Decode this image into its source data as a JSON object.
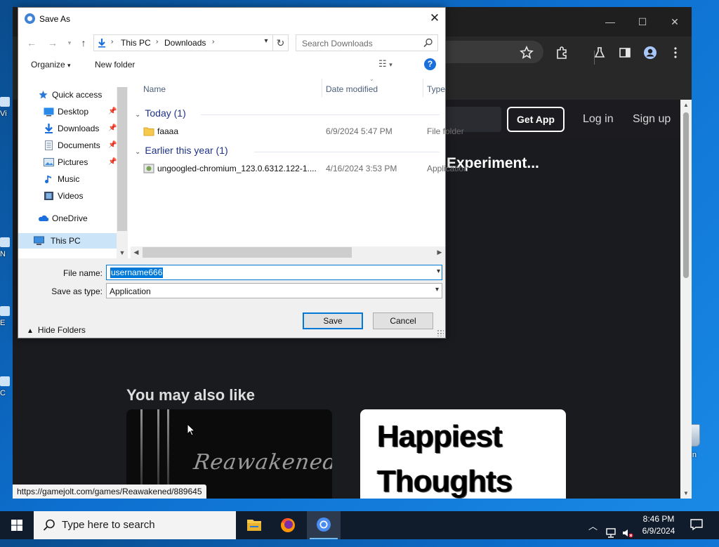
{
  "desktop": {
    "left_labels": [
      "Vi",
      "N",
      "E",
      "C"
    ],
    "recycle_label": "Bin"
  },
  "browser": {
    "window_controls": [
      "—",
      "☐",
      "✕"
    ],
    "site": {
      "get_app": "Get App",
      "log_in": "Log in",
      "sign_up": "Sign up",
      "headline": "Experiment...",
      "section_title": "You may also like",
      "card1_art": "Reawakened",
      "card2_art_line1": "Happiest",
      "card2_art_line2": "Thoughts"
    },
    "status_url": "https://gamejolt.com/games/Reawakened/889645"
  },
  "dialog": {
    "title": "Save As",
    "close": "✕",
    "address": {
      "crumbs": [
        "This PC",
        "Downloads"
      ]
    },
    "search_placeholder": "Search Downloads",
    "commands": {
      "organize": "Organize",
      "new_folder": "New folder"
    },
    "nav": {
      "quick_access": "Quick access",
      "items": [
        {
          "label": "Desktop",
          "icon": "desktop-icon"
        },
        {
          "label": "Downloads",
          "icon": "downloads-icon"
        },
        {
          "label": "Documents",
          "icon": "documents-icon"
        },
        {
          "label": "Pictures",
          "icon": "pictures-icon"
        },
        {
          "label": "Music",
          "icon": "music-icon"
        },
        {
          "label": "Videos",
          "icon": "videos-icon"
        }
      ],
      "onedrive": "OneDrive",
      "this_pc": "This PC"
    },
    "columns": {
      "name": "Name",
      "date_modified": "Date modified",
      "type": "Type"
    },
    "groups": [
      {
        "title": "Today (1)",
        "files": [
          {
            "name": "faaaa",
            "date": "6/9/2024 5:47 PM",
            "type": "File folder"
          }
        ]
      },
      {
        "title": "Earlier this year (1)",
        "files": [
          {
            "name": "ungoogled-chromium_123.0.6312.122-1....",
            "date": "4/16/2024 3:53 PM",
            "type": "Application"
          }
        ]
      }
    ],
    "file_name_label": "File name:",
    "file_name_value": "username666",
    "save_type_label": "Save as type:",
    "save_type_value": "Application",
    "hide_folders": "Hide Folders",
    "save_button": "Save",
    "cancel_button": "Cancel"
  },
  "taskbar": {
    "search_placeholder": "Type here to search",
    "clock_time": "8:46 PM",
    "clock_date": "6/9/2024"
  }
}
